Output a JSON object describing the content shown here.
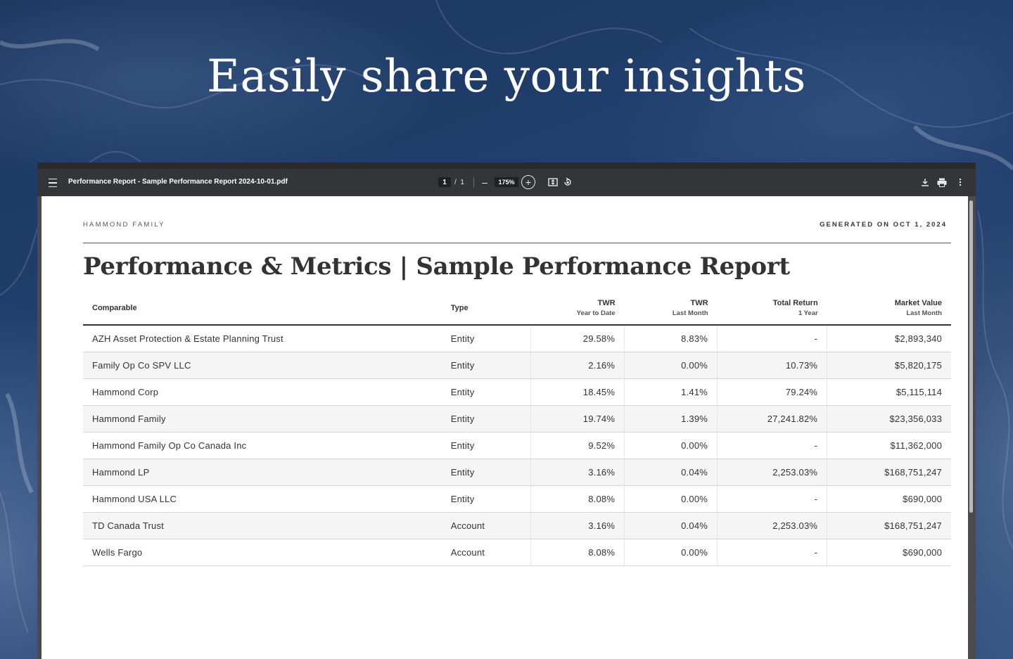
{
  "hero": {
    "headline": "Easily share your insights"
  },
  "viewer": {
    "file_title": "Performance Report - Sample Performance Report 2024-10-01.pdf",
    "current_page": "1",
    "page_separator": "/",
    "total_pages": "1",
    "zoom": "175%",
    "zoom_out_symbol": "–",
    "zoom_in_symbol": "+",
    "icons": [
      "menu-icon",
      "zoom-out-icon",
      "zoom-in-icon",
      "fit-page-icon",
      "rotate-icon",
      "download-icon",
      "print-icon",
      "more-options-icon"
    ]
  },
  "report": {
    "client": "HAMMOND FAMILY",
    "generated": "GENERATED ON OCT 1, 2024",
    "title": "Performance & Metrics | Sample Performance Report",
    "columns": [
      {
        "main": "Comparable",
        "sub": ""
      },
      {
        "main": "Type",
        "sub": ""
      },
      {
        "main": "TWR",
        "sub": "Year to Date"
      },
      {
        "main": "TWR",
        "sub": "Last Month"
      },
      {
        "main": "Total Return",
        "sub": "1 Year"
      },
      {
        "main": "Market Value",
        "sub": "Last Month"
      }
    ],
    "rows": [
      [
        "AZH Asset Protection & Estate Planning Trust",
        "Entity",
        "29.58%",
        "8.83%",
        "-",
        "$2,893,340"
      ],
      [
        "Family Op Co SPV LLC",
        "Entity",
        "2.16%",
        "0.00%",
        "10.73%",
        "$5,820,175"
      ],
      [
        "Hammond Corp",
        "Entity",
        "18.45%",
        "1.41%",
        "79.24%",
        "$5,115,114"
      ],
      [
        "Hammond Family",
        "Entity",
        "19.74%",
        "1.39%",
        "27,241.82%",
        "$23,356,033"
      ],
      [
        "Hammond Family Op Co Canada Inc",
        "Entity",
        "9.52%",
        "0.00%",
        "-",
        "$11,362,000"
      ],
      [
        "Hammond LP",
        "Entity",
        "3.16%",
        "0.04%",
        "2,253.03%",
        "$168,751,247"
      ],
      [
        "Hammond USA LLC",
        "Entity",
        "8.08%",
        "0.00%",
        "-",
        "$690,000"
      ],
      [
        "TD Canada Trust",
        "Account",
        "3.16%",
        "0.04%",
        "2,253.03%",
        "$168,751,247"
      ],
      [
        "Wells Fargo",
        "Account",
        "8.08%",
        "0.00%",
        "-",
        "$690,000"
      ]
    ]
  }
}
